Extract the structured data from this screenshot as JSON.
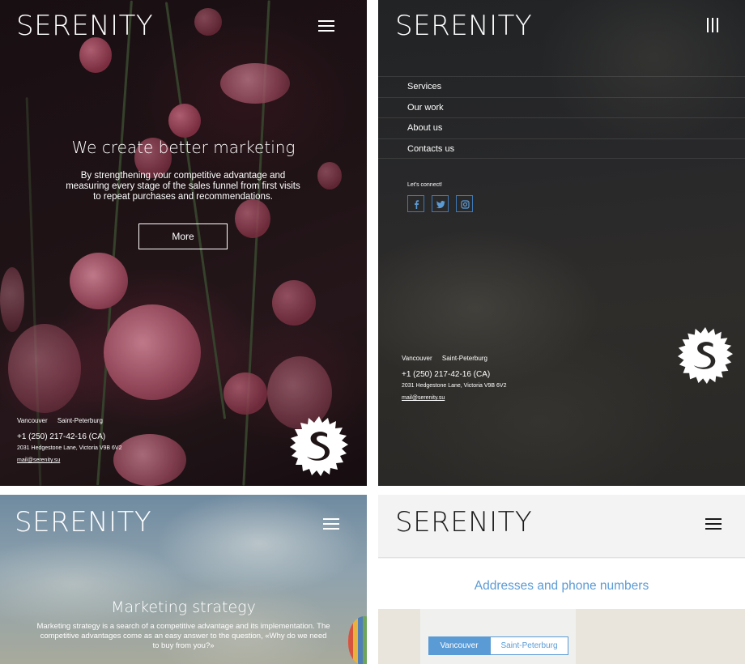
{
  "brand": {
    "logo_text": "SERENITY"
  },
  "panel_home": {
    "hero_title": "We create better marketing",
    "hero_text_lines": [
      "By strengthening your competitive advantage and",
      "measuring every stage of the sales funnel from first visits",
      "to repeat purchases and recommendations."
    ],
    "more_button": "More",
    "contacts": {
      "city_1": "Vancouver",
      "city_2": "Saint-Peterburg",
      "phone": "+1 (250) 217-42-16 (CA)",
      "address": "2031 Hedgestone Lane, Victoria V9B 6V2",
      "email": "mail@serenity.su"
    }
  },
  "panel_menu": {
    "menu_items": [
      "Services",
      "Our work",
      "About us",
      "Contacts us"
    ],
    "connect_label": "Let's connect!",
    "social_icons": [
      "facebook-icon",
      "twitter-icon",
      "instagram-icon"
    ],
    "contacts": {
      "city_1": "Vancouver",
      "city_2": "Saint-Peterburg",
      "phone": "+1 (250) 217-42-16 (CA)",
      "address": "2031 Hedgestone Lane, Victoria V9B 6V2",
      "email": "mail@serenity.su"
    }
  },
  "panel_strategy": {
    "title": "Marketing strategy",
    "text_lines": [
      "Marketing strategy is a search of a competitive advantage and its implementation. The",
      "competitive advantages come as an easy answer to the question, «Why do we need",
      "to buy from you?»"
    ]
  },
  "panel_addresses": {
    "title": "Addresses and phone numbers",
    "tabs": [
      "Vancouver",
      "Saint-Peterburg"
    ],
    "active_tab": "Vancouver"
  },
  "colors": {
    "accent_blue": "#5b9bd5",
    "social_border": "#3f78b6",
    "text_light": "#ffffff"
  }
}
